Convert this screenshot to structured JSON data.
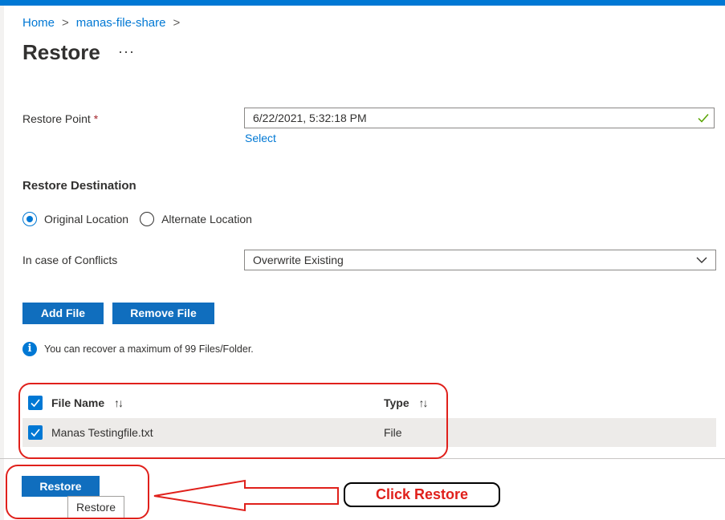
{
  "breadcrumb": {
    "home": "Home",
    "share": "manas-file-share",
    "sep": ">"
  },
  "page": {
    "title": "Restore",
    "more": "···"
  },
  "restore_point": {
    "label": "Restore Point",
    "required_mark": "*",
    "value": "6/22/2021, 5:32:18 PM",
    "select_link": "Select"
  },
  "destination": {
    "heading": "Restore Destination",
    "options": [
      "Original Location",
      "Alternate Location"
    ],
    "selected": "Original Location"
  },
  "conflicts": {
    "label": "In case of Conflicts",
    "value": "Overwrite Existing"
  },
  "buttons": {
    "add_file": "Add File",
    "remove_file": "Remove File",
    "restore": "Restore"
  },
  "info": {
    "icon": "info-icon",
    "text": "You can recover a maximum of 99 Files/Folder."
  },
  "table": {
    "columns": [
      "File Name",
      "Type"
    ],
    "sort_glyph": "↑↓",
    "rows": [
      {
        "name": "Manas Testingfile.txt",
        "type": "File",
        "checked": true
      }
    ]
  },
  "tooltip": "Restore",
  "annotation": {
    "callout": "Click Restore",
    "color": "#e0201b"
  },
  "colors": {
    "accent": "#0078d4",
    "annotation": "#e0201b"
  }
}
